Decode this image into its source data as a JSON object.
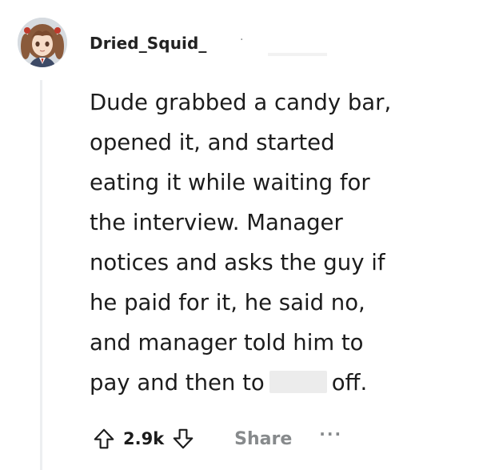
{
  "comment": {
    "author": "Dried_Squid_",
    "separator": "·",
    "body_lines": [
      "Dude grabbed a candy bar,",
      "opened it, and started",
      "eating it while waiting for",
      "the interview. Manager",
      "notices and asks the guy if",
      "he paid for it, he said no,",
      "and manager told him to",
      "pay and then to",
      "off."
    ]
  },
  "actions": {
    "vote_count": "2.9k",
    "share_label": "Share",
    "more_label": "···"
  },
  "icons": {
    "upvote": "arrow-up-outline-icon",
    "downvote": "arrow-down-outline-icon"
  },
  "colors": {
    "text": "#1c1c1c",
    "muted": "#878a8c",
    "thread_line": "#edeff1",
    "redaction": "#ececec"
  }
}
